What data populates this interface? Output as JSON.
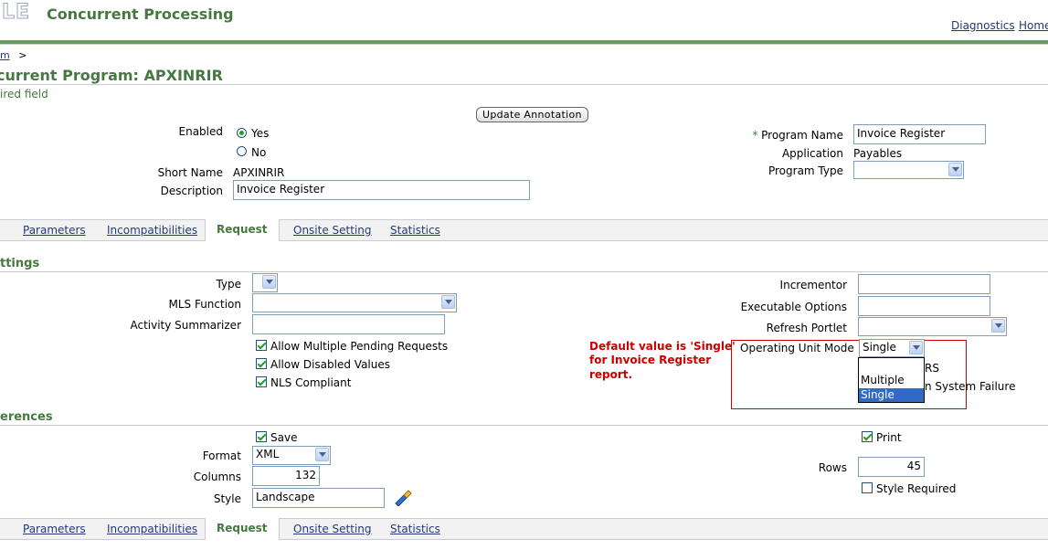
{
  "header": {
    "logo_text": "LE",
    "app_title": "Concurrent Processing",
    "links": [
      "Diagnostics",
      "Home"
    ]
  },
  "breadcrumb": {
    "item": "m",
    "separator": ">"
  },
  "page": {
    "title": "current Program: APXINRIR",
    "required_hint": "ired field"
  },
  "update_button": "Update Annotation",
  "main": {
    "enabled_label": "Enabled",
    "yes_label": "Yes",
    "no_label": "No",
    "short_name_label": "Short Name",
    "short_name_value": "APXINRIR",
    "description_label": "Description",
    "description_value": "Invoice Register",
    "program_name_label": "Program Name",
    "program_name_value": "Invoice Register",
    "application_label": "Application",
    "application_value": "Payables",
    "program_type_label": "Program Type",
    "program_type_value": ""
  },
  "tabs": [
    "Parameters",
    "Incompatibilities",
    "Request",
    "Onsite Setting",
    "Statistics"
  ],
  "active_tab": "Request",
  "settings": {
    "section_title": "ttings",
    "type_label": "Type",
    "mls_label": "MLS Function",
    "activity_label": "Activity Summarizer",
    "allow_multiple": "Allow Multiple Pending Requests",
    "allow_disabled": "Allow Disabled Values",
    "nls": "NLS Compliant",
    "incrementor_label": "Incrementor",
    "exec_options_label": "Executable Options",
    "refresh_label": "Refresh Portlet",
    "ou_mode_label": "Operating Unit Mode",
    "ou_mode_value": "Single",
    "ou_options": [
      "Multiple",
      "Single"
    ],
    "hidden_text_1": "RS",
    "hidden_text_2": "n System Failure"
  },
  "annotation": {
    "line1": "Default value is 'Single'",
    "line2": "for Invoice Register",
    "line3": "report.",
    "color": "#cc0000"
  },
  "preferences": {
    "section_title": "erences",
    "save_label": "Save",
    "format_label": "Format",
    "format_value": "XML",
    "columns_label": "Columns",
    "columns_value": "132",
    "style_label": "Style",
    "style_value": "Landscape",
    "print_label": "Print",
    "rows_label": "Rows",
    "rows_value": "45",
    "style_required_label": "Style Required"
  }
}
